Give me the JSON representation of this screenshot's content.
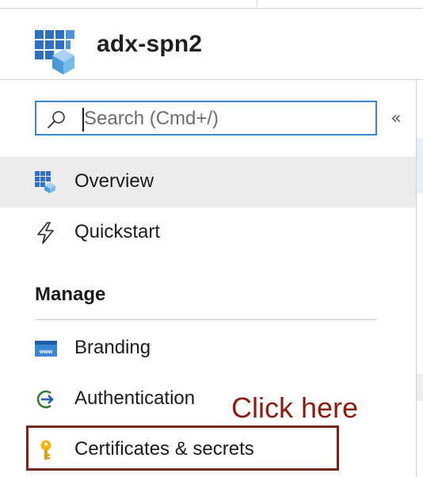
{
  "app": {
    "title": "adx-spn2",
    "icon": "app-registration-icon"
  },
  "search": {
    "placeholder": "Search (Cmd+/)",
    "value": "",
    "icon": "search-icon"
  },
  "sidebar": {
    "collapse_label": "«",
    "items": [
      {
        "label": "Overview",
        "icon": "overview-grid-icon",
        "selected": true
      },
      {
        "label": "Quickstart",
        "icon": "lightning-icon",
        "selected": false
      }
    ],
    "sections": [
      {
        "heading": "Manage",
        "items": [
          {
            "label": "Branding",
            "icon": "www-branding-icon"
          },
          {
            "label": "Authentication",
            "icon": "authentication-arrow-icon"
          },
          {
            "label": "Certificates & secrets",
            "icon": "key-icon"
          }
        ]
      }
    ]
  },
  "annotation": {
    "text": "Click here",
    "color": "#8b1d12"
  },
  "colors": {
    "accent": "#3a86d4",
    "selected_bg": "#ececec",
    "annotation_border": "#7a2616"
  }
}
